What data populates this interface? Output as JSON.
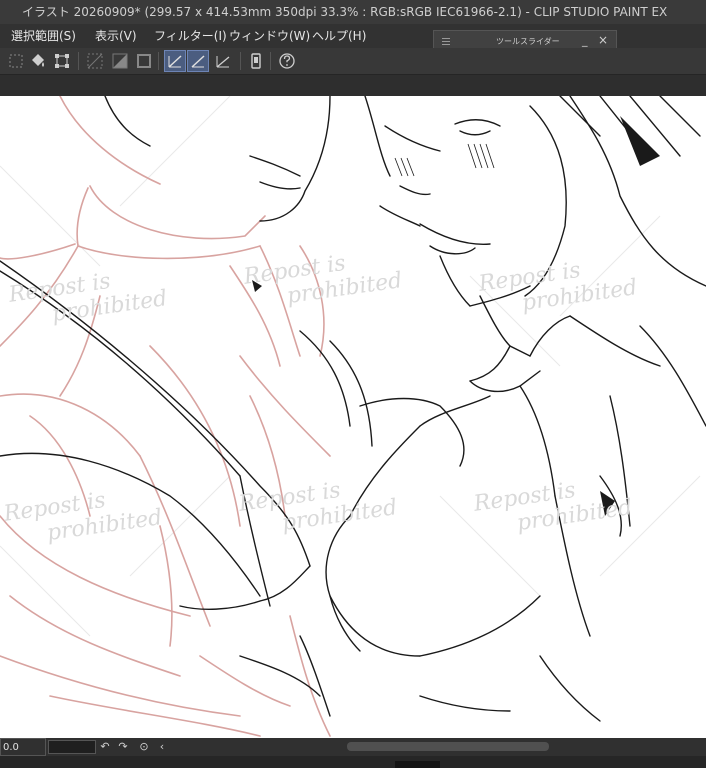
{
  "titlebar": {
    "title": "イラスト 20260909* (299.57 x 414.53mm 350dpi 33.3% : RGB:sRGB IEC61966-2.1)  - CLIP STUDIO PAINT EX"
  },
  "menu": {
    "items": [
      {
        "label": "選択範囲(S)"
      },
      {
        "label": "表示(V)"
      },
      {
        "label": "フィルター(I)"
      },
      {
        "label": "ウィンドウ(W)"
      },
      {
        "label": "ヘルプ(H)"
      }
    ]
  },
  "toolbar": {
    "icons": [
      "selection-icon",
      "fill-icon",
      "transform-icon",
      "grid-icon",
      "gradient-icon",
      "frame-icon",
      "ruler-icon",
      "ruler-active-icon",
      "perspective-icon",
      "tablet-icon",
      "help-icon"
    ]
  },
  "tool_slider_panel": {
    "title": "ツールスライダー",
    "minimize": "_",
    "close": "×"
  },
  "canvas": {
    "watermarks": [
      {
        "text": "Repost is"
      },
      {
        "text": "prohibited"
      }
    ]
  },
  "statusbar": {
    "zoom": "0.0",
    "undo": "↶",
    "redo": "↷",
    "reset": "⊙",
    "prev": "‹"
  },
  "colors": {
    "sketch": "#d8a3a0",
    "ink": "#1a1a1a",
    "accent": "#4b5d80"
  }
}
